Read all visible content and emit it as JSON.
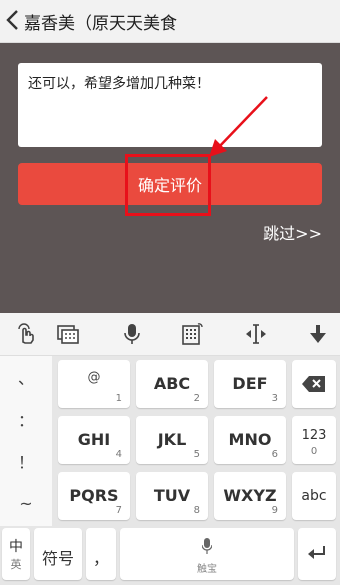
{
  "theme": {
    "bg": "#5d5555",
    "accent": "#ea4a3e"
  },
  "header": {
    "title": "嘉香美（原天天美食"
  },
  "review": {
    "text": "还可以，希望多增加几种菜！"
  },
  "confirm_button": {
    "label": "确定评价"
  },
  "skip_link": {
    "label": "跳过>>"
  },
  "keyboard": {
    "toolbar_icons": [
      "gesture-icon",
      "keyboard-switch-icon",
      "microphone-icon",
      "numpad-icon",
      "cursor-icon",
      "hide-keyboard-icon"
    ],
    "side_symbols": [
      "、",
      "：",
      "！",
      "~"
    ],
    "rows": [
      [
        {
          "main": "@",
          "num": "1"
        },
        {
          "main": "ABC",
          "num": "2"
        },
        {
          "main": "DEF",
          "num": "3"
        }
      ],
      [
        {
          "main": "GHI",
          "num": "4"
        },
        {
          "main": "JKL",
          "num": "5"
        },
        {
          "main": "MNO",
          "num": "6"
        }
      ],
      [
        {
          "main": "PQRS",
          "num": "7"
        },
        {
          "main": "TUV",
          "num": "8"
        },
        {
          "main": "WXYZ",
          "num": "9"
        }
      ]
    ],
    "num_key": "123",
    "num_key_sub": "0",
    "abc_key": "abc",
    "lang_key": {
      "main": "中",
      "sub": "英"
    },
    "symbol_key": "符号",
    "comma_key": "，",
    "space_key": "触宝"
  }
}
